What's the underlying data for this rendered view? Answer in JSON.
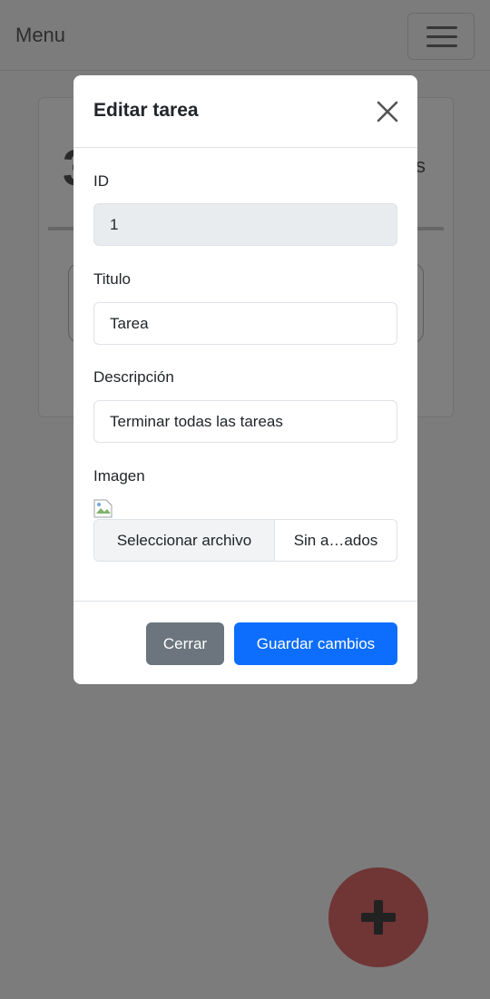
{
  "navbar": {
    "brand": "Menu"
  },
  "background": {
    "card_number": "3",
    "card_letter": "s"
  },
  "modal": {
    "title": "Editar tarea",
    "fields": [
      {
        "label": "ID",
        "value": "1"
      },
      {
        "label": "Titulo",
        "value": "Tarea"
      },
      {
        "label": "Descripción",
        "value": "Terminar todas las tareas"
      }
    ],
    "image": {
      "label": "Imagen",
      "choose_button": "Seleccionar archivo",
      "file_status": "Sin a…ados"
    },
    "footer": {
      "close_label": "Cerrar",
      "save_label": "Guardar cambios"
    }
  },
  "colors": {
    "primary": "#0d6efd",
    "secondary": "#6c757d",
    "fab": "#e06a6a",
    "backdrop": "rgba(0,0,0,0.5)"
  },
  "icons": {
    "close": "close-icon",
    "menu": "hamburger-icon",
    "fab": "plus-icon"
  }
}
